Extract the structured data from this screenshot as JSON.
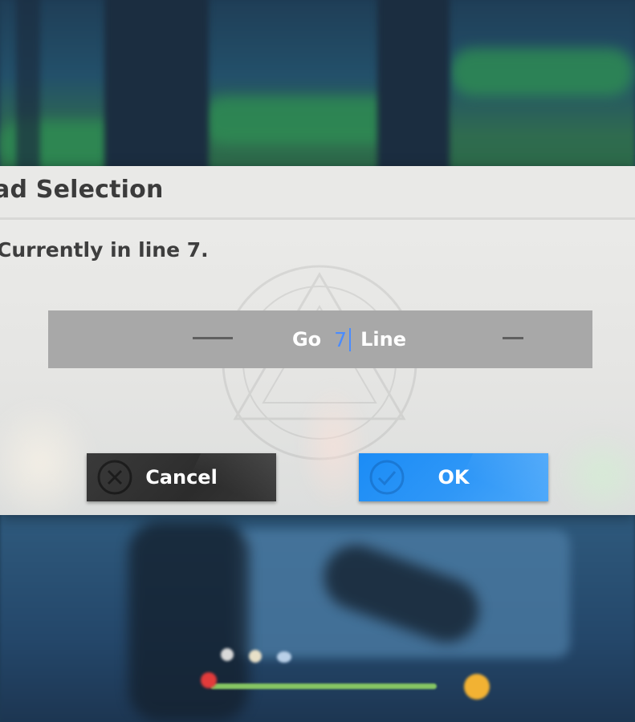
{
  "dialog": {
    "title": "ad Selection",
    "message": "Currently in line 7."
  },
  "spinner": {
    "prefix": "Go",
    "value": "7",
    "suffix": "Line",
    "decrement_icon": "minus-icon",
    "increment_icon": "minus-icon"
  },
  "buttons": {
    "cancel_label": "Cancel",
    "cancel_icon": "x-circle-icon",
    "ok_label": "OK",
    "ok_icon": "check-circle-icon"
  },
  "colors": {
    "accent": "#1b8cf6",
    "cancel_bg": "#2f2f2f",
    "value_text": "#4a8cff",
    "spinner_bg": "#a8a8a8",
    "dialog_bg": "#e6e6e4"
  }
}
